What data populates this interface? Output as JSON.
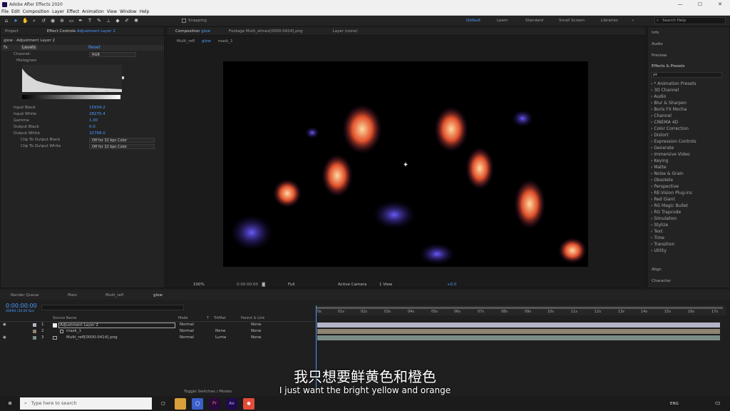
{
  "window": {
    "title": "Adobe After Effects 2020",
    "min": "—",
    "max": "☐",
    "close": "✕"
  },
  "menu": [
    "File",
    "Edit",
    "Composition",
    "Layer",
    "Effect",
    "Animation",
    "View",
    "Window",
    "Help"
  ],
  "toolbar": {
    "snapping": "Snapping"
  },
  "workspaces": [
    "Default",
    "Learn",
    "Standard",
    "Small Screen",
    "Libraries"
  ],
  "search_help": {
    "placeholder": "Search Help"
  },
  "project_panel": {
    "tab_project": "Project",
    "tab_effect_controls": "Effect Controls",
    "effect_controls_layer": "Adjustment Layer 2",
    "header": "glow · Adjustment Layer 2"
  },
  "levels": {
    "name": "Levels",
    "reset": "Reset",
    "channel_label": "Channel:",
    "channel_value": "RGB",
    "histogram_label": "Histogram",
    "input_black_label": "Input Black",
    "input_black_value": "15934.2",
    "input_white_label": "Input White",
    "input_white_value": "28270.4",
    "gamma_label": "Gamma",
    "gamma_value": "1.00",
    "output_black_label": "Output Black",
    "output_black_value": "0.0",
    "output_white_label": "Output White",
    "output_white_value": "32768.0",
    "clip_black_label": "Clip To Output Black",
    "clip_black_value": "Off for 32 bpc Color",
    "clip_white_label": "Clip To Output White",
    "clip_white_value": "Off for 32 bpc Color"
  },
  "viewer": {
    "tab_composition": "Composition",
    "tab_composition_name": "glow",
    "tab_footage": "Footage  Multi_atmos[0000-0414].png",
    "tab_layer": "Layer  (none)",
    "crumbs": [
      "Multi_refl",
      "glow",
      "mask_1"
    ],
    "zoom": "100%",
    "timecode": "0:00:00:00",
    "resolution": "Full",
    "camera": "Active Camera",
    "views": "1 View",
    "exposure": "+0.0"
  },
  "right_panels": {
    "info": "Info",
    "audio": "Audio",
    "preview": "Preview",
    "effects_presets": "Effects & Presets",
    "search_placeholder": "ρ▾",
    "categories": [
      "* Animation Presets",
      "3D Channel",
      "Audio",
      "Blur & Sharpen",
      "Boris FX Mocha",
      "Channel",
      "CINEMA 4D",
      "Color Correction",
      "Distort",
      "Expression Controls",
      "Generate",
      "Immersive Video",
      "Keying",
      "Matte",
      "Noise & Grain",
      "Obsolete",
      "Perspective",
      "RE:Vision Plug-ins",
      "Red Giant",
      "RG Magic Bullet",
      "RG Trapcode",
      "Simulation",
      "Stylize",
      "Text",
      "Time",
      "Transition",
      "Utility"
    ],
    "align": "Align",
    "character": "Character"
  },
  "timeline": {
    "tabs": [
      "Render Queue",
      "Main",
      "Multi_refl",
      "glow"
    ],
    "timecode": "0:00:00:00",
    "timecode_sub": "00000 (30.00 fps)",
    "col_source": "Source Name",
    "col_mode": "Mode",
    "col_t": "T",
    "col_trkmat": "TrkMat",
    "col_parent": "Parent & Link",
    "layers": [
      {
        "num": "1",
        "name": "Adjustment Layer 2",
        "mode": "Normal",
        "trkmat": "",
        "parent": "None",
        "color": "#b4b4c8"
      },
      {
        "num": "2",
        "name": "mask_1",
        "mode": "Normal",
        "trkmat": "None",
        "parent": "None",
        "color": "#8f8472"
      },
      {
        "num": "3",
        "name": "Multi_refl[0000-0414].png",
        "mode": "Normal",
        "trkmat": "Luma",
        "parent": "None",
        "color": "#7a8c86"
      }
    ],
    "ruler": [
      "0s",
      "01s",
      "02s",
      "03s",
      "04s",
      "05s",
      "06s",
      "07s",
      "08s",
      "09s",
      "10s",
      "11s",
      "12s",
      "13s",
      "14s",
      "15s",
      "16s",
      "17s"
    ],
    "toggle": "Toggle Switches / Modes"
  },
  "taskbar": {
    "search_placeholder": "Type here to search",
    "lang": "ENG"
  },
  "subtitles": {
    "cn": "我只想要鲜黄色和橙色",
    "en": "I just want the bright yellow and orange"
  }
}
